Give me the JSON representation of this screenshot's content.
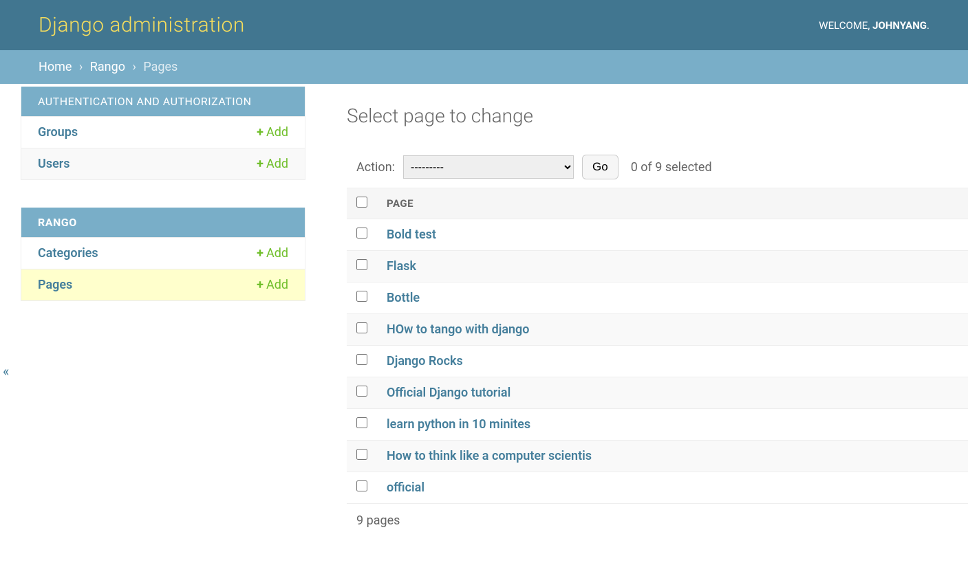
{
  "header": {
    "title": "Django administration",
    "welcome": "WELCOME,",
    "username": "JOHNYANG",
    "dot": "."
  },
  "breadcrumbs": {
    "home": "Home",
    "app": "Rango",
    "current": "Pages"
  },
  "sidebar": {
    "toggle": "«",
    "sections": [
      {
        "caption": "AUTHENTICATION AND AUTHORIZATION",
        "models": [
          {
            "name": "Groups",
            "add": "Add",
            "alt": false,
            "active": false
          },
          {
            "name": "Users",
            "add": "Add",
            "alt": true,
            "active": false
          }
        ]
      },
      {
        "caption": "RANGO",
        "models": [
          {
            "name": "Categories",
            "add": "Add",
            "alt": false,
            "active": false
          },
          {
            "name": "Pages",
            "add": "Add",
            "alt": false,
            "active": true
          }
        ]
      }
    ]
  },
  "content": {
    "title": "Select page to change",
    "action_label": "Action:",
    "action_placeholder": "---------",
    "go_label": "Go",
    "selection_counter": "0 of 9 selected",
    "column_header": "PAGE",
    "rows": [
      "Bold test",
      "Flask",
      "Bottle",
      "HOw to tango with django",
      "Django Rocks",
      "Official Django tutorial",
      "learn python in 10 minites",
      "How to think like a computer scientis",
      "official"
    ],
    "paginator": "9 pages"
  }
}
